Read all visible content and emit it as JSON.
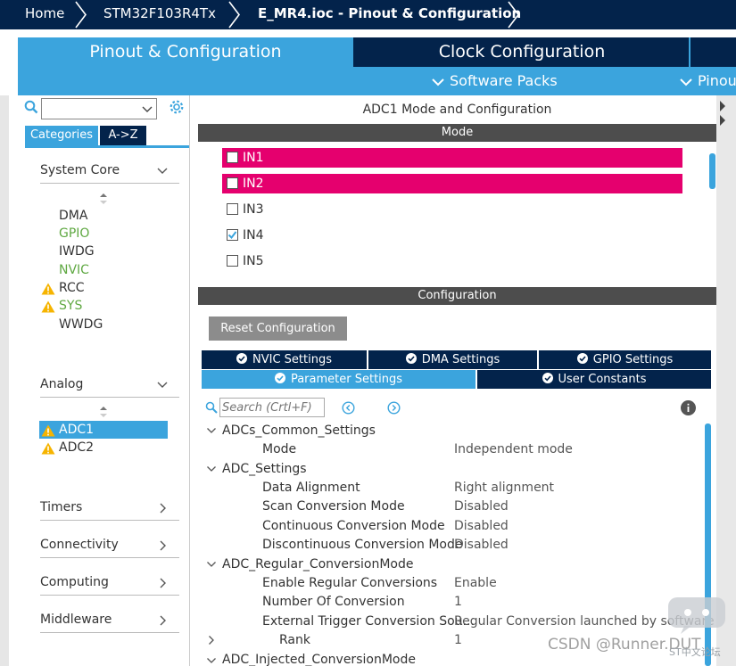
{
  "breadcrumb": {
    "items": [
      "Home",
      "STM32F103R4Tx",
      "E_MR4.ioc - Pinout & Configuration"
    ]
  },
  "tabs": {
    "pinout": "Pinout & Configuration",
    "clock": "Clock Configuration",
    "software_packs": "Software Packs",
    "pinout_view": "Pinou"
  },
  "left": {
    "search_placeholder": "",
    "view_buttons": {
      "categories": "Categories",
      "az": "A->Z"
    },
    "sections": {
      "system_core": "System Core",
      "analog": "Analog",
      "timers": "Timers",
      "connectivity": "Connectivity",
      "computing": "Computing",
      "middleware": "Middleware"
    },
    "system_core_items": [
      {
        "label": "DMA",
        "status": "normal"
      },
      {
        "label": "GPIO",
        "status": "configured"
      },
      {
        "label": "IWDG",
        "status": "normal"
      },
      {
        "label": "NVIC",
        "status": "configured"
      },
      {
        "label": "RCC",
        "status": "warning"
      },
      {
        "label": "SYS",
        "status": "warning"
      },
      {
        "label": "WWDG",
        "status": "normal"
      }
    ],
    "analog_items": [
      {
        "label": "ADC1",
        "status": "warning",
        "selected": true
      },
      {
        "label": "ADC2",
        "status": "warning",
        "selected": false
      }
    ]
  },
  "panel": {
    "title": "ADC1 Mode and Configuration",
    "mode_header": "Mode",
    "mode_channels": [
      {
        "label": "IN1",
        "checked": false,
        "highlighted": true
      },
      {
        "label": "IN2",
        "checked": false,
        "highlighted": true
      },
      {
        "label": "IN3",
        "checked": false,
        "highlighted": false
      },
      {
        "label": "IN4",
        "checked": true,
        "highlighted": false
      },
      {
        "label": "IN5",
        "checked": false,
        "highlighted": false
      }
    ],
    "config_header": "Configuration",
    "reset_button": "Reset Configuration",
    "settings_tabs": {
      "nvic": "NVIC Settings",
      "dma": "DMA Settings",
      "gpio": "GPIO Settings",
      "parameter": "Parameter Settings",
      "user_constants": "User Constants"
    },
    "param_search_placeholder": "Search (Crtl+F)",
    "groups": {
      "adcs_common": {
        "title": "ADCs_Common_Settings",
        "params": [
          {
            "name": "Mode",
            "value": "Independent mode"
          }
        ]
      },
      "adc_settings": {
        "title": "ADC_Settings",
        "params": [
          {
            "name": "Data Alignment",
            "value": "Right alignment"
          },
          {
            "name": "Scan Conversion Mode",
            "value": "Disabled"
          },
          {
            "name": "Continuous Conversion Mode",
            "value": "Disabled"
          },
          {
            "name": "Discontinuous Conversion Mode",
            "value": "Disabled"
          }
        ]
      },
      "adc_regular": {
        "title": "ADC_Regular_ConversionMode",
        "params": [
          {
            "name": "Enable Regular Conversions",
            "value": "Enable"
          },
          {
            "name": "Number Of Conversion",
            "value": "1"
          },
          {
            "name": "External Trigger Conversion Sou...",
            "value": "Regular Conversion launched by software"
          },
          {
            "name": "Rank",
            "value": "1"
          }
        ]
      },
      "adc_injected": {
        "title": "ADC_Injected_ConversionMode"
      }
    }
  },
  "watermark": {
    "text": "CSDN @Runner.DUT",
    "small": "ST中文论坛"
  },
  "colors": {
    "navy": "#03234b",
    "blue": "#3ba4dd",
    "pink": "#e5006e",
    "header_gray": "#4d4d4d",
    "green": "#5fa842",
    "warning": "#f6b400"
  }
}
